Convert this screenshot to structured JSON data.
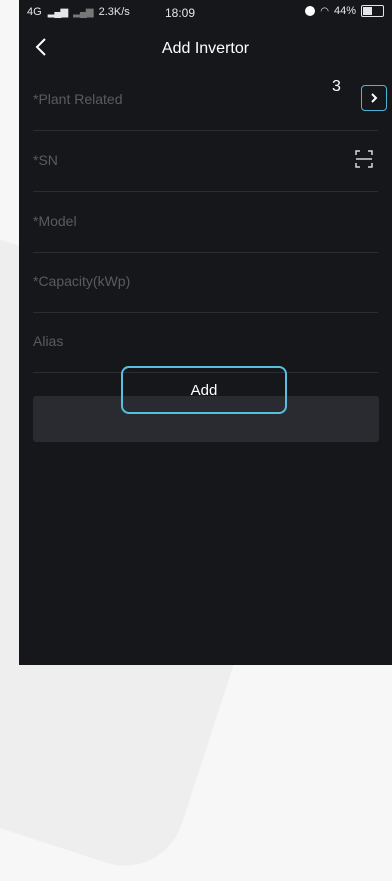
{
  "status_bar": {
    "network": "4G",
    "speed": "2.3K/s",
    "time": "18:09",
    "battery": "44%"
  },
  "header": {
    "title": "Add Invertor"
  },
  "annotation": {
    "text": "3"
  },
  "form": {
    "rows": [
      {
        "label": "*Plant Related"
      },
      {
        "label": "*SN"
      },
      {
        "label": "*Model"
      },
      {
        "label": "*Capacity(kWp)"
      },
      {
        "label": "Alias"
      }
    ]
  },
  "actions": {
    "add_label": "Add"
  },
  "icons": {
    "back": "back-arrow-icon",
    "chevron": "chevron-right-icon",
    "scan": "scan-icon"
  },
  "colors": {
    "background": "#16171b",
    "divider": "#2c2d32",
    "label": "#5a5b60",
    "highlight": "#59bfdf",
    "button": "#2a2b30"
  }
}
